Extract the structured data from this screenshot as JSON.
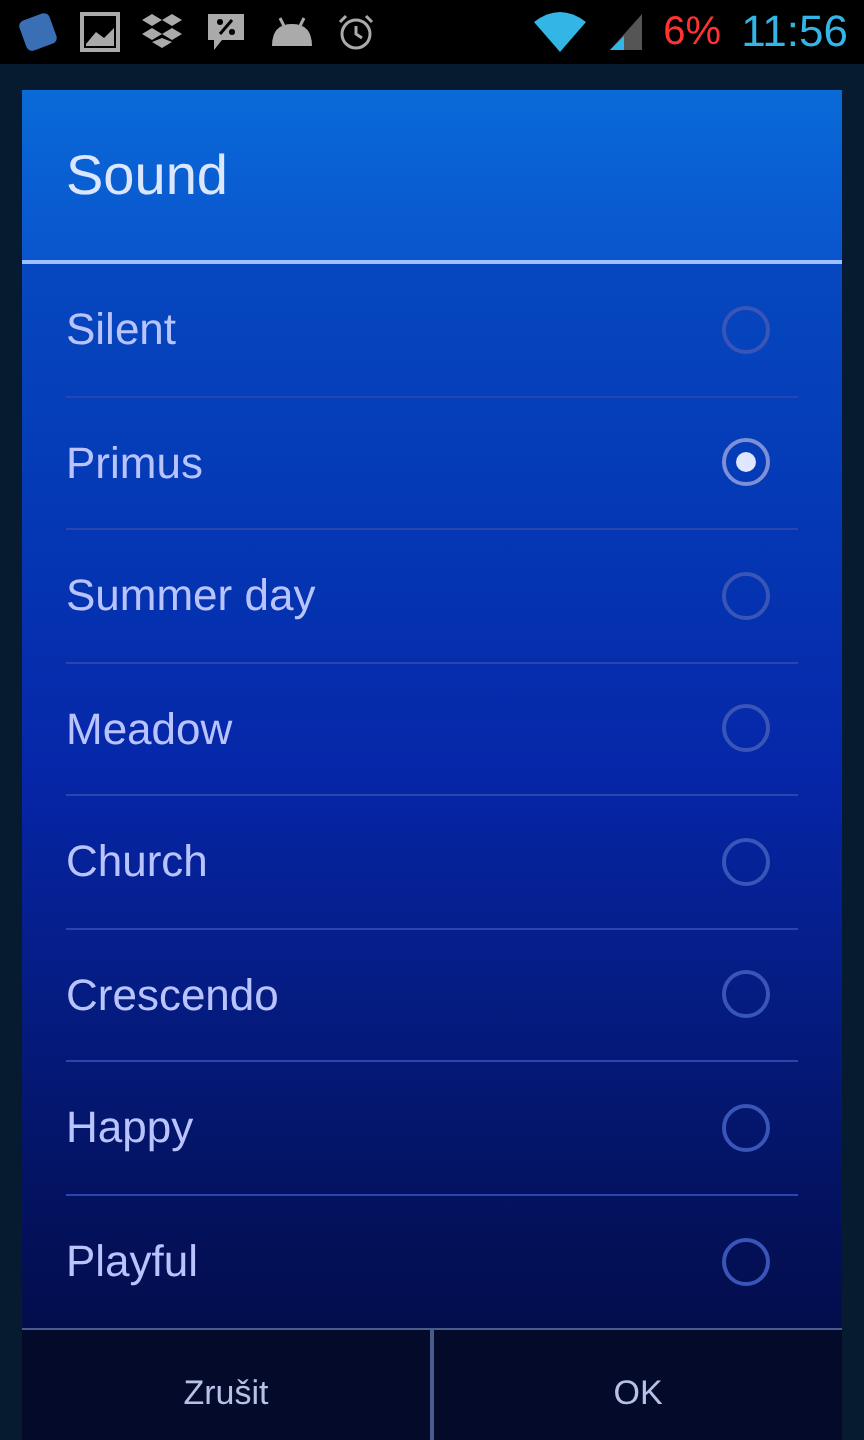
{
  "status_bar": {
    "battery": "6%",
    "time": "11:56"
  },
  "dialog": {
    "title": "Sound",
    "options": [
      {
        "label": "Silent",
        "selected": false
      },
      {
        "label": "Primus",
        "selected": true
      },
      {
        "label": "Summer day",
        "selected": false
      },
      {
        "label": "Meadow",
        "selected": false
      },
      {
        "label": "Church",
        "selected": false
      },
      {
        "label": "Crescendo",
        "selected": false
      },
      {
        "label": "Happy",
        "selected": false
      },
      {
        "label": "Playful",
        "selected": false
      }
    ],
    "buttons": [
      "Zrušit",
      "OK"
    ]
  }
}
